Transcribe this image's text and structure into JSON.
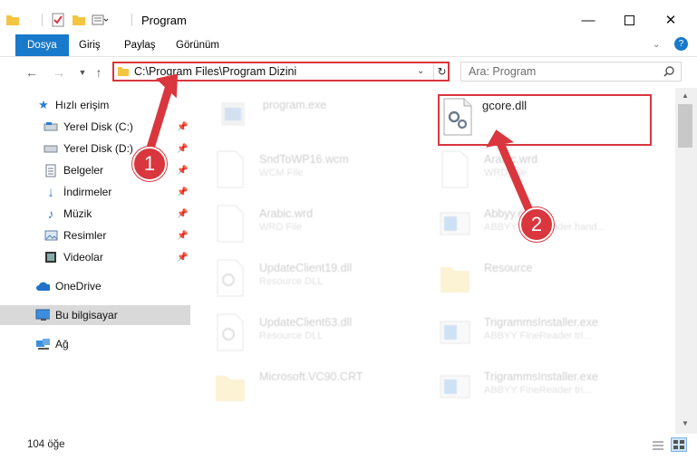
{
  "window": {
    "title": "Program"
  },
  "ribbon": {
    "tabs": [
      "Dosya",
      "Giriş",
      "Paylaş",
      "Görünüm"
    ]
  },
  "address": {
    "path": "C:\\Program Files\\Program Dizini",
    "search_placeholder": "Ara: Program"
  },
  "sidebar": {
    "quick_access": "Hızlı erişim",
    "items": [
      {
        "label": "Yerel Disk (C:)",
        "icon": "drive-icon"
      },
      {
        "label": "Yerel Disk (D:)",
        "icon": "drive-icon"
      },
      {
        "label": "Belgeler",
        "icon": "documents-icon"
      },
      {
        "label": "İndirmeler",
        "icon": "download-icon"
      },
      {
        "label": "Müzik",
        "icon": "music-icon"
      },
      {
        "label": "Resimler",
        "icon": "pictures-icon"
      },
      {
        "label": "Videolar",
        "icon": "videos-icon"
      }
    ],
    "onedrive": "OneDrive",
    "this_pc": "Bu bilgisayar",
    "network": "Ağ"
  },
  "files": [
    {
      "name": "program.exe",
      "sub": ""
    },
    {
      "name": "gcore.dll",
      "sub": ""
    },
    {
      "name": "SndToWP16.wcm",
      "sub": "WCM File"
    },
    {
      "name": "Arabic.wrd",
      "sub": "WRD File"
    },
    {
      "name": "Arabic.wrd",
      "sub": "WRD File"
    },
    {
      "name": "Abbyy.exe",
      "sub": "ABBYY FineReader hand..."
    },
    {
      "name": "UpdateClient19.dll",
      "sub": "Resource DLL"
    },
    {
      "name": "Resource",
      "sub": ""
    },
    {
      "name": "UpdateClient63.dll",
      "sub": "Resource DLL"
    },
    {
      "name": "TrigrammsInstaller.exe",
      "sub": "ABBYY FineReader tri..."
    },
    {
      "name": "Microsoft.VC90.CRT",
      "sub": ""
    },
    {
      "name": "TrigrammsInstaller.exe",
      "sub": "ABBYY FineReader tri..."
    }
  ],
  "callouts": [
    "1",
    "2"
  ],
  "status": {
    "count": "104 öğe"
  }
}
